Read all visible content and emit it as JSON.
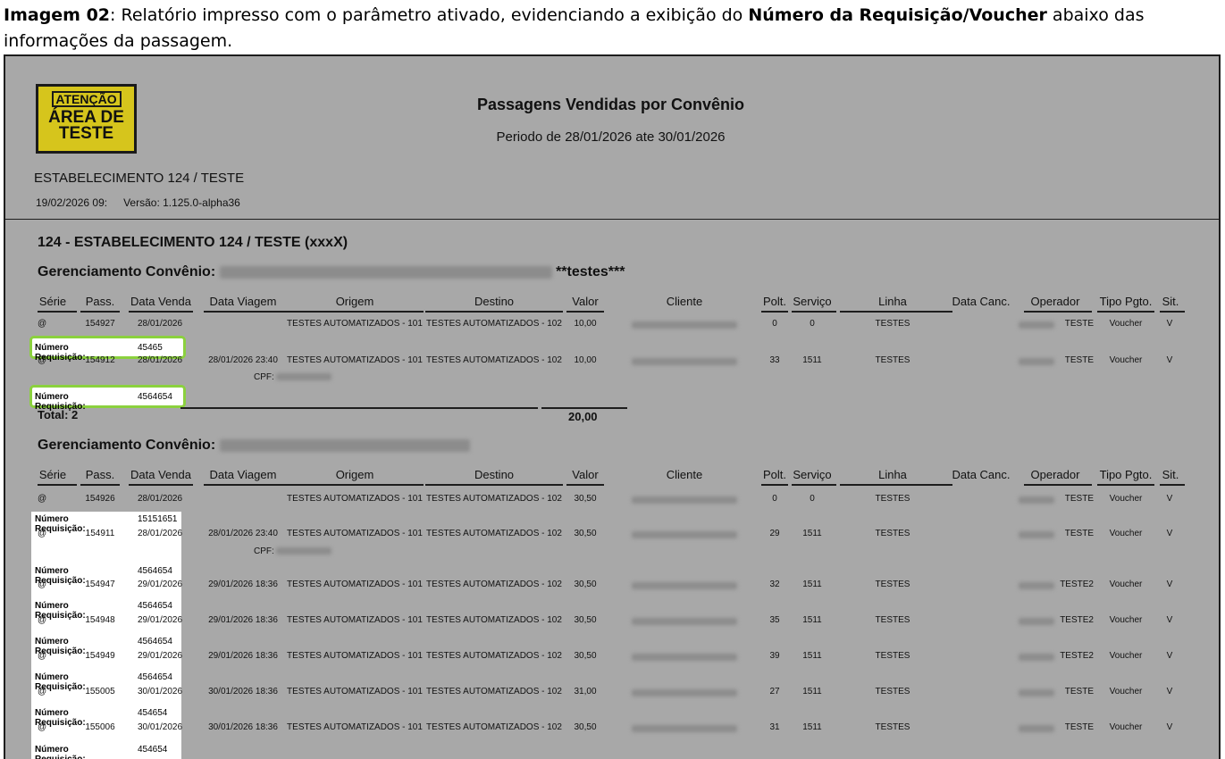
{
  "caption": {
    "label": "Imagem 02",
    "part1": ": Relatório impresso com o parâmetro ativado, evidenciando a exibição do ",
    "bold": "Número da Requisição/Voucher",
    "part2": " abaixo das informações da passagem."
  },
  "report": {
    "logo": {
      "line1": "ATENÇÃO",
      "line2": "ÁREA DE",
      "line3": "TESTE"
    },
    "title": "Passagens Vendidas por Convênio",
    "period": "Periodo de 28/01/2026 ate 30/01/2026",
    "establishment": "ESTABELECIMENTO 124 / TESTE",
    "printed": "19/02/2026 09:",
    "version": "Versão: 1.125.0-alpha36",
    "company": "124 - ESTABELECIMENTO 124 / TESTE (xxxX)",
    "columns": {
      "serie": "Série",
      "pass": "Pass.",
      "data_venda": "Data Venda",
      "data_viagem": "Data Viagem",
      "origem": "Origem",
      "destino": "Destino",
      "valor": "Valor",
      "cliente": "Cliente",
      "polt": "Polt.",
      "servico": "Serviço",
      "linha": "Linha",
      "data_canc": "Data Canc.",
      "operador": "Operador",
      "tipo_pgto": "Tipo Pgto.",
      "sit": "Sit."
    },
    "req_label": "Número Requisição:",
    "cpf_label": "CPF:",
    "groups": [
      {
        "label": "Gerenciamento Convênio:",
        "suffix": "**testes***",
        "rows": [
          {
            "serie": "@",
            "pass": "154927",
            "data_venda": "28/01/2026",
            "data_viagem": "",
            "origem": "TESTES AUTOMATIZADOS - 101",
            "destino": "TESTES AUTOMATIZADOS - 102",
            "valor": "10,00",
            "polt": "0",
            "servico": "0",
            "linha": "TESTES",
            "operador": "TESTE",
            "tipo": "Voucher",
            "sit": "V",
            "req": "45465"
          },
          {
            "serie": "@",
            "pass": "154912",
            "data_venda": "28/01/2026",
            "data_viagem": "28/01/2026 23:40",
            "origem": "TESTES AUTOMATIZADOS - 101",
            "destino": "TESTES AUTOMATIZADOS - 102",
            "valor": "10,00",
            "polt": "33",
            "servico": "1511",
            "linha": "TESTES",
            "operador": "TESTE",
            "tipo": "Voucher",
            "sit": "V",
            "req": "4564654"
          }
        ],
        "total_label": "Total: 2",
        "total_value": "20,00"
      },
      {
        "label": "Gerenciamento Convênio:",
        "suffix": "",
        "rows": [
          {
            "serie": "@",
            "pass": "154926",
            "data_venda": "28/01/2026",
            "data_viagem": "",
            "origem": "TESTES AUTOMATIZADOS - 101",
            "destino": "TESTES AUTOMATIZADOS - 102",
            "valor": "30,50",
            "polt": "0",
            "servico": "0",
            "linha": "TESTES",
            "operador": "TESTE",
            "tipo": "Voucher",
            "sit": "V",
            "req": "15151651"
          },
          {
            "serie": "@",
            "pass": "154911",
            "data_venda": "28/01/2026",
            "data_viagem": "28/01/2026 23:40",
            "origem": "TESTES AUTOMATIZADOS - 101",
            "destino": "TESTES AUTOMATIZADOS - 102",
            "valor": "30,50",
            "polt": "29",
            "servico": "1511",
            "linha": "TESTES",
            "operador": "TESTE",
            "tipo": "Voucher",
            "sit": "V",
            "req": "4564654"
          },
          {
            "serie": "@",
            "pass": "154947",
            "data_venda": "29/01/2026",
            "data_viagem": "29/01/2026 18:36",
            "origem": "TESTES AUTOMATIZADOS - 101",
            "destino": "TESTES AUTOMATIZADOS - 102",
            "valor": "30,50",
            "polt": "32",
            "servico": "1511",
            "linha": "TESTES",
            "operador": "TESTE2",
            "tipo": "Voucher",
            "sit": "V",
            "req": "4564654"
          },
          {
            "serie": "@",
            "pass": "154948",
            "data_venda": "29/01/2026",
            "data_viagem": "29/01/2026 18:36",
            "origem": "TESTES AUTOMATIZADOS - 101",
            "destino": "TESTES AUTOMATIZADOS - 102",
            "valor": "30,50",
            "polt": "35",
            "servico": "1511",
            "linha": "TESTES",
            "operador": "TESTE2",
            "tipo": "Voucher",
            "sit": "V",
            "req": "4564654"
          },
          {
            "serie": "@",
            "pass": "154949",
            "data_venda": "29/01/2026",
            "data_viagem": "29/01/2026 18:36",
            "origem": "TESTES AUTOMATIZADOS - 101",
            "destino": "TESTES AUTOMATIZADOS - 102",
            "valor": "30,50",
            "polt": "39",
            "servico": "1511",
            "linha": "TESTES",
            "operador": "TESTE2",
            "tipo": "Voucher",
            "sit": "V",
            "req": "4564654"
          },
          {
            "serie": "@",
            "pass": "155005",
            "data_venda": "30/01/2026",
            "data_viagem": "30/01/2026 18:36",
            "origem": "TESTES AUTOMATIZADOS - 101",
            "destino": "TESTES AUTOMATIZADOS - 102",
            "valor": "31,00",
            "polt": "27",
            "servico": "1511",
            "linha": "TESTES",
            "operador": "TESTE",
            "tipo": "Voucher",
            "sit": "V",
            "req": "454654"
          },
          {
            "serie": "@",
            "pass": "155006",
            "data_venda": "30/01/2026",
            "data_viagem": "30/01/2026 18:36",
            "origem": "TESTES AUTOMATIZADOS - 101",
            "destino": "TESTES AUTOMATIZADOS - 102",
            "valor": "30,50",
            "polt": "31",
            "servico": "1511",
            "linha": "TESTES",
            "operador": "TESTE",
            "tipo": "Voucher",
            "sit": "V",
            "req": "454654"
          }
        ]
      }
    ]
  }
}
